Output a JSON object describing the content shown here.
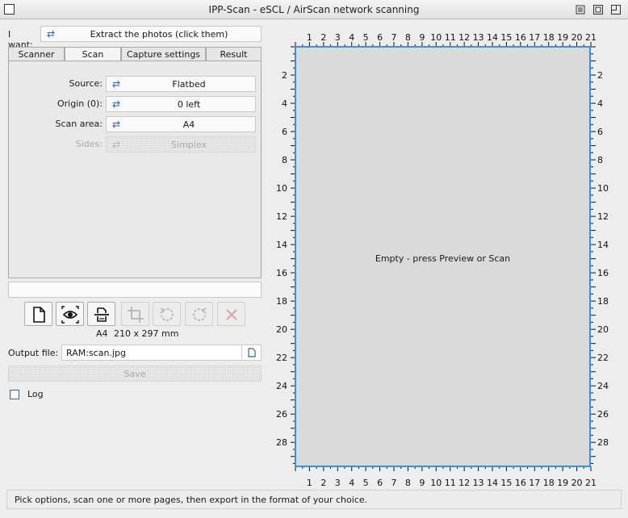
{
  "window": {
    "title": "IPP-Scan - eSCL / AirScan network scanning"
  },
  "want": {
    "label": "I want:",
    "value": "Extract the photos (click them)"
  },
  "tabs": [
    "Scanner",
    "Scan",
    "Capture settings",
    "Result"
  ],
  "scan_options": {
    "source_label": "Source:",
    "source_value": "Flatbed",
    "origin_label": "Origin (0):",
    "origin_value": "0 left",
    "area_label": "Scan area:",
    "area_value": "A4",
    "sides_label": "Sides:",
    "sides_value": "Simplex"
  },
  "size_info": {
    "paper": "A4",
    "dims": "210 x 297 mm"
  },
  "output": {
    "label": "Output file:",
    "value": "RAM:scan.jpg"
  },
  "save_label": "Save",
  "log_label": "Log",
  "preview": {
    "message": "Empty - press Preview or Scan",
    "h_ticks": [
      "1",
      "2",
      "3",
      "4",
      "5",
      "6",
      "7",
      "8",
      "9",
      "10",
      "11",
      "12",
      "13",
      "14",
      "15",
      "16",
      "17",
      "18",
      "19",
      "20",
      "21"
    ],
    "v_ticks": [
      "2",
      "4",
      "6",
      "8",
      "10",
      "12",
      "14",
      "16",
      "18",
      "20",
      "22",
      "24",
      "26",
      "28"
    ]
  },
  "status": "Pick options, scan one or more pages, then export in the format of your choice.",
  "colors": {
    "accent": "#3d8ee0",
    "cycle_icon": "#2b67b0",
    "cancel_disabled": "#e8a0a0"
  }
}
